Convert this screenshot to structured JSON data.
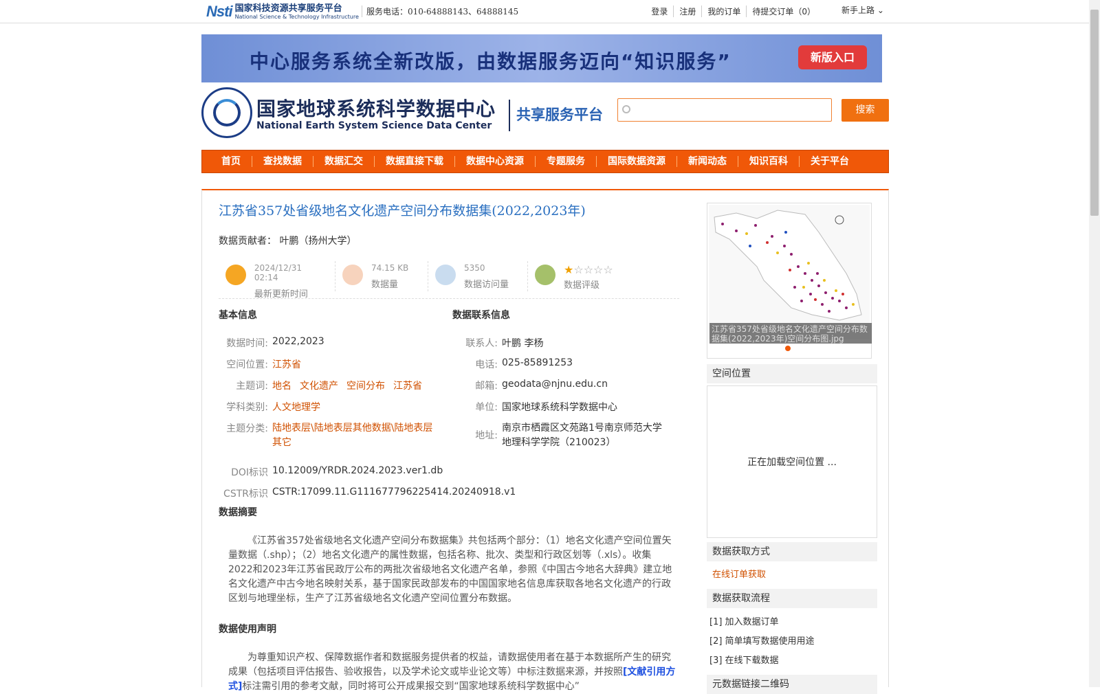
{
  "topbar": {
    "nsti_mark": "Nsti",
    "nsti_cn": "国家科技资源共享服务平台",
    "nsti_en": "National Science & Technology Infrastructure",
    "phone": "服务电话：010-64888143、64888145",
    "links": [
      "登录",
      "注册",
      "我的订单",
      "待提交订单（0）"
    ],
    "newbie": "新手上路 ⌄"
  },
  "banner": {
    "text": "中心服务系统全新改版，由数据服务迈向“知识服务”",
    "button": "新版入口"
  },
  "logo": {
    "cn": "国家地球系统科学数据中心",
    "en": "National Earth System Science Data Center",
    "platform": "共享服务平台"
  },
  "search": {
    "placeholder": "",
    "button": "搜索"
  },
  "nav": [
    "首页",
    "查找数据",
    "数据汇交",
    "数据直接下载",
    "数据中心资源",
    "专题服务",
    "国际数据资源",
    "新闻动态",
    "知识百科",
    "关于平台"
  ],
  "dataset": {
    "title": "江苏省357处省级地名文化遗产空间分布数据集(2022,2023年)",
    "contributor_label": "数据贡献者：",
    "contributor": "叶鹏（扬州大学）"
  },
  "stats": [
    {
      "value": "2024/12/31 02:14",
      "label": "最新更新时间",
      "color": "#f5a623"
    },
    {
      "value": "74.15 KB",
      "label": "数据量",
      "color": "#f7d3bd"
    },
    {
      "value": "5350",
      "label": "数据访问量",
      "color": "#c9dcef"
    },
    {
      "value": "",
      "label": "数据评级",
      "color": "#a5c06a",
      "rating": 1,
      "max": 5
    }
  ],
  "basic": {
    "heading": "基本信息",
    "time_k": "数据时间:",
    "time_v": "2022,2023",
    "space_k": "空间位置:",
    "space_v": "江苏省",
    "keywords_k": "主题词:",
    "keywords": [
      "地名",
      "文化遗产",
      "空间分布",
      "江苏省"
    ],
    "discipline_k": "学科类别:",
    "discipline_v": "人文地理学",
    "category_k": "主题分类:",
    "category_v1": "陆地表层\\陆地表层其他数据\\陆地表层",
    "category_v2": "其它",
    "doi_k": "DOI标识",
    "doi_v": "10.12009/YRDR.2024.2023.ver1.db",
    "cstr_k": "CSTR标识",
    "cstr_v": "CSTR:17099.11.G111677796225414.20240918.v1"
  },
  "contact": {
    "heading": "数据联系信息",
    "person_k": "联系人:",
    "person_v": "叶鹏 李杨",
    "tel_k": "电话:",
    "tel_v": "025-85891253",
    "email_k": "邮箱:",
    "email_v": "geodata@njnu.edu.cn",
    "unit_k": "单位:",
    "unit_v": "国家地球系统科学数据中心",
    "addr_k": "地址:",
    "addr_v1": "南京市栖霞区文苑路1号南京师范大学",
    "addr_v2": "地理科学学院（210023）"
  },
  "abstract": {
    "heading": "数据摘要",
    "text": "《江苏省357处省级地名文化遗产空间分布数据集》共包括两个部分：（1）地名文化遗产空间位置矢量数据（.shp）；（2）地名文化遗产的属性数据，包括名称、批次、类型和行政区划等（.xls）。收集2022和2023年江苏省民政厅公布的两批次省级地名文化遗产名单，参照《中国古今地名大辞典》建立地名文化遗产中古今地名映射关系，基于国家民政部发布的中国国家地名信息库获取各地名文化遗产的行政区划与地理坐标，生产了江苏省级地名文化遗产空间位置分布数据。"
  },
  "usage": {
    "heading": "数据使用声明",
    "text1": "为尊重知识产权、保障数据作者和数据服务提供者的权益，请数据使用者在基于本数据所产生的研究成果（包括项目评估报告、验收报告，以及学术论文或毕业论文等）中标注数据来源，并按照",
    "link": "[文献引用方式]",
    "text2": "标注需引用的参考文献，同时将可公开成果报交到“国家地球系统科学数据中心”"
  },
  "side": {
    "caption": "江苏省357处省级地名文化遗产空间分布数据集(2022,2023年)空间分布图.jpg",
    "space_heading": "空间位置",
    "loading": "正在加载空间位置 ...",
    "access_heading": "数据获取方式",
    "access_link": "在线订单获取",
    "flow_heading": "数据获取流程",
    "steps": [
      "[1] 加入数据订单",
      "[2] 简单填写数据使用用途",
      "[3] 在线下载数据"
    ],
    "qr_heading": "元数据链接二维码"
  }
}
